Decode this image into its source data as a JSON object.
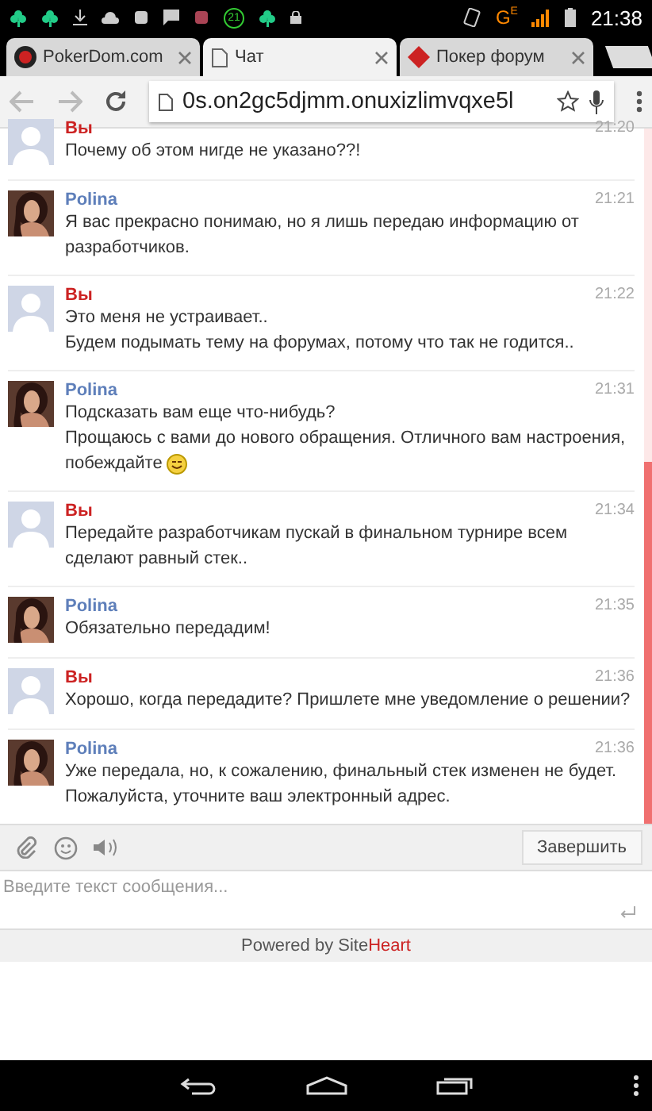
{
  "status_bar": {
    "badge": "21",
    "network": "G",
    "network_sub": "E",
    "time": "21:38"
  },
  "tabs": [
    {
      "label": "PokerDom.com",
      "selected": false,
      "kind": "pd"
    },
    {
      "label": "Чат",
      "selected": true,
      "kind": "page"
    },
    {
      "label": "Покер форум",
      "selected": false,
      "kind": "diamond"
    }
  ],
  "address_bar": {
    "url": "0s.on2gc5djmm.onuxizlimvqxe5l"
  },
  "messages": [
    {
      "kind": "user",
      "name": "Вы",
      "time": "21:20",
      "paragraphs": [
        "Почему об этом нигде не указано??!"
      ],
      "smiley": false,
      "cut": true
    },
    {
      "kind": "operator",
      "name": "Polina",
      "time": "21:21",
      "paragraphs": [
        "Я вас прекрасно понимаю, но я лишь передаю информацию от разработчиков."
      ],
      "smiley": false,
      "cut": false
    },
    {
      "kind": "user",
      "name": "Вы",
      "time": "21:22",
      "paragraphs": [
        "Это меня не устраивает..",
        "Будем подымать тему на форумах, потому что так не годится.."
      ],
      "smiley": false,
      "cut": false
    },
    {
      "kind": "operator",
      "name": "Polina",
      "time": "21:31",
      "paragraphs": [
        "Подсказать вам еще что-нибудь?",
        "Прощаюсь с вами до нового обращения. Отличного вам настроения,",
        "побеждайте"
      ],
      "smiley": true,
      "cut": false
    },
    {
      "kind": "user",
      "name": "Вы",
      "time": "21:34",
      "paragraphs": [
        "Передайте разработчикам пускай в финальном турнире всем сделают равный стек.."
      ],
      "smiley": false,
      "cut": false
    },
    {
      "kind": "operator",
      "name": "Polina",
      "time": "21:35",
      "paragraphs": [
        "Обязательно передадим!"
      ],
      "smiley": false,
      "cut": false
    },
    {
      "kind": "user",
      "name": "Вы",
      "time": "21:36",
      "paragraphs": [
        "Хорошо, когда передадите? Пришлете мне уведомление о решении?"
      ],
      "smiley": false,
      "cut": false
    },
    {
      "kind": "operator",
      "name": "Polina",
      "time": "21:36",
      "paragraphs": [
        "Уже передала, но, к сожалению, финальный стек изменен не будет.",
        "Пожалуйста, уточните ваш электронный адрес."
      ],
      "smiley": false,
      "cut": false
    }
  ],
  "composer": {
    "finish_button": "Завершить",
    "placeholder": "Введите текст сообщения..."
  },
  "footer": {
    "prefix": "Powered by Site",
    "highlight": "Heart"
  }
}
